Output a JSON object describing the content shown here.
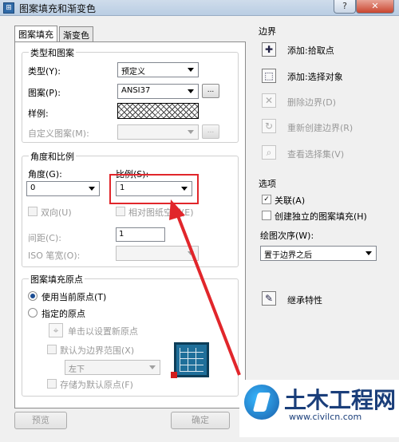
{
  "window": {
    "title": "图案填充和渐变色",
    "help_label": "?",
    "close_label": "✕"
  },
  "tabs": [
    {
      "label": "图案填充"
    },
    {
      "label": "渐变色"
    }
  ],
  "type_pattern": {
    "group_title": "类型和图案",
    "type_label": "类型(Y):",
    "type_value": "预定义",
    "pattern_label": "图案(P):",
    "pattern_value": "ANSI37",
    "browse_label": "...",
    "swatch_label": "样例:",
    "custom_label": "自定义图案(M):",
    "custom_value": "",
    "custom_browse_label": "..."
  },
  "angle_scale": {
    "group_title": "角度和比例",
    "angle_label": "角度(G):",
    "angle_value": "0",
    "scale_label": "比例(S):",
    "scale_value": "1",
    "double_label": "双向(U)",
    "relative_label": "相对图纸空间(E)",
    "spacing_label": "间距(C):",
    "spacing_value": "1",
    "iso_label": "ISO 笔宽(O):",
    "iso_value": ""
  },
  "origin": {
    "group_title": "图案填充原点",
    "use_current_label": "使用当前原点(T)",
    "specified_label": "指定的原点",
    "click_set_label": "单击以设置新原点",
    "default_extent_label": "默认为边界范围(X)",
    "position_value": "左下",
    "store_default_label": "存储为默认原点(F)"
  },
  "boundaries": {
    "title": "边界",
    "add_pick_label": "添加:拾取点",
    "add_select_label": "添加:选择对象",
    "remove_label": "删除边界(D)",
    "recreate_label": "重新创建边界(R)",
    "view_label": "查看选择集(V)"
  },
  "options": {
    "title": "选项",
    "associative_label": "关联(A)",
    "associative_checked": true,
    "separate_label": "创建独立的图案填充(H)",
    "separate_checked": false,
    "draw_order_label": "绘图次序(W):",
    "draw_order_value": "置于边界之后"
  },
  "inherit_label": "继承特性",
  "bottom": {
    "preview_label": "预览",
    "ok_label": "确定"
  },
  "watermark": {
    "title": "土木工程网",
    "url": "www.civilcn.com"
  },
  "colors": {
    "annotation": "#e1262b",
    "titlebar": "#b9cde3"
  }
}
